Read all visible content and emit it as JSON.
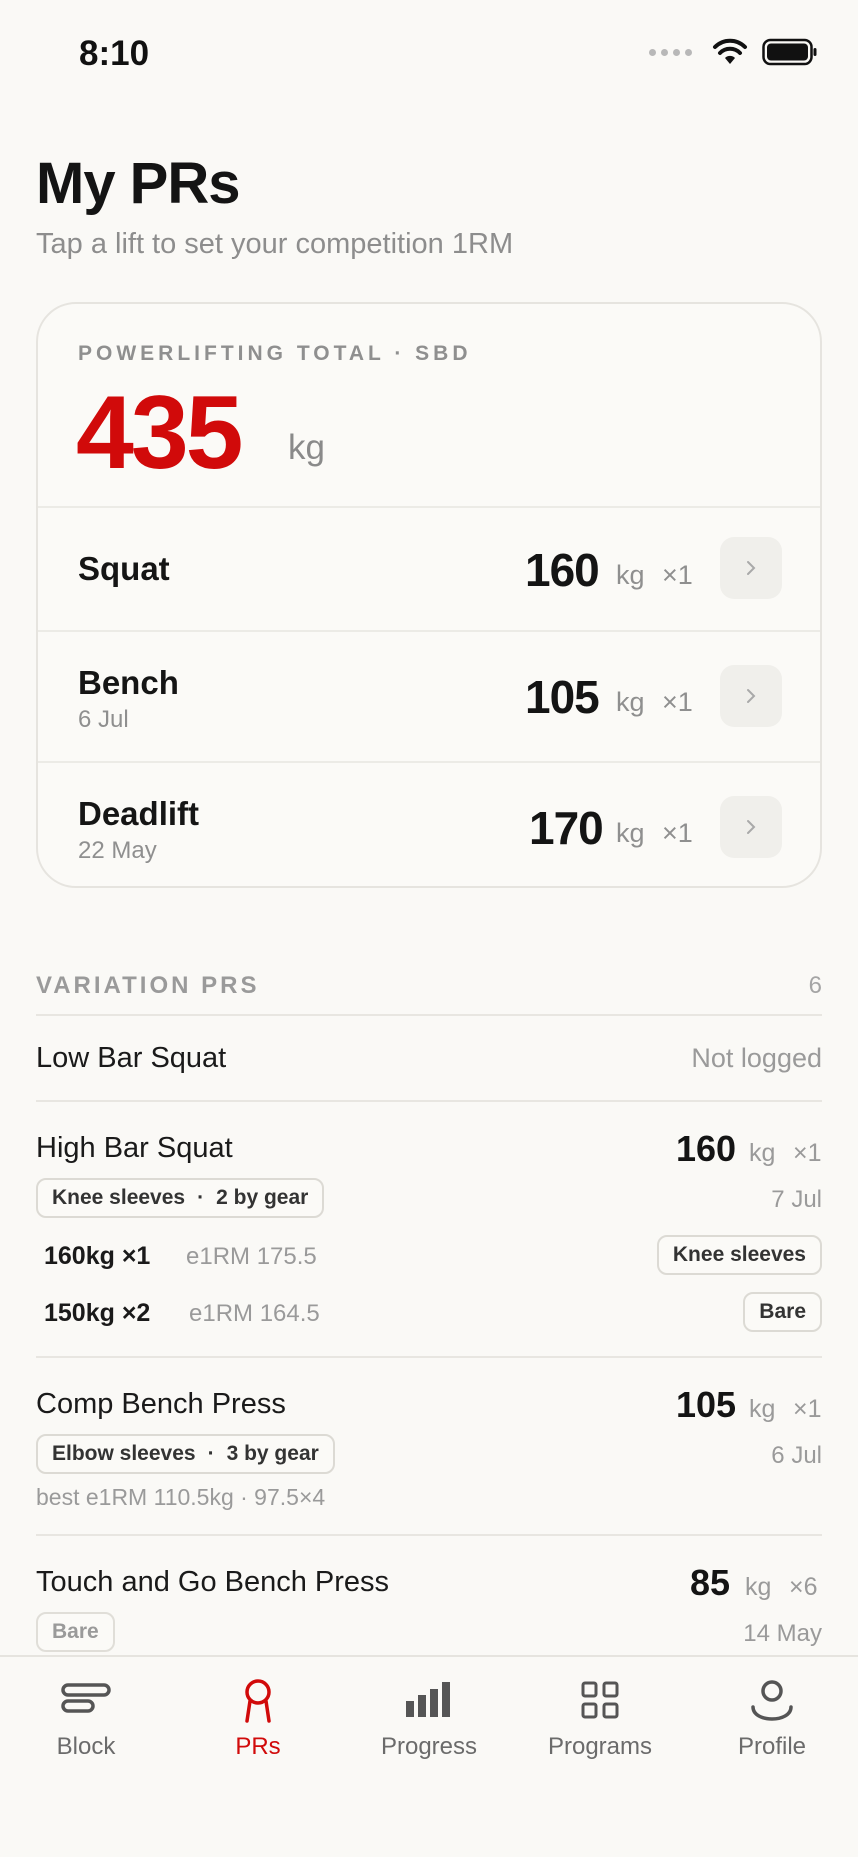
{
  "status": {
    "time": "8:10"
  },
  "header": {
    "title": "My PRs",
    "subtitle": "Tap a lift to set your competition 1RM"
  },
  "total": {
    "label": "POWERLIFTING TOTAL · SBD",
    "value": "435",
    "unit": "kg",
    "lifts": [
      {
        "name": "Squat",
        "date": "",
        "value": "160",
        "unit": "kg",
        "reps": "×1"
      },
      {
        "name": "Bench",
        "date": "6 Jul",
        "value": "105",
        "unit": "kg",
        "reps": "×1"
      },
      {
        "name": "Deadlift",
        "date": "22 May",
        "value": "170",
        "unit": "kg",
        "reps": "×1"
      }
    ]
  },
  "variations": {
    "label": "VARIATION PRS",
    "count": "6",
    "items": [
      {
        "name": "Low Bar Squat",
        "status": "Not logged"
      },
      {
        "name": "High Bar Squat",
        "value": "160",
        "unit": "kg",
        "reps": "×1",
        "date": "7 Jul",
        "chip_gear": "Knee sleeves",
        "chip_sep": "·",
        "chip_count": "2 by gear",
        "sets": [
          {
            "weight_reps": "160kg ×1",
            "e1rm": "e1RM 175.5",
            "gear": "Knee sleeves"
          },
          {
            "weight_reps": "150kg ×2",
            "e1rm": "e1RM 164.5",
            "gear": "Bare"
          }
        ]
      },
      {
        "name": "Comp Bench Press",
        "value": "105",
        "unit": "kg",
        "reps": "×1",
        "date": "6 Jul",
        "chip_gear": "Elbow sleeves",
        "chip_sep": "·",
        "chip_count": "3 by gear",
        "best": "best e1RM 110.5kg · 97.5×4"
      },
      {
        "name": "Touch and Go Bench Press",
        "value": "85",
        "unit": "kg",
        "reps": "×6",
        "date": "14 May",
        "chip_gear": "Bare"
      }
    ]
  },
  "tabs": [
    {
      "label": "Block",
      "icon": "block-icon"
    },
    {
      "label": "PRs",
      "icon": "prs-icon"
    },
    {
      "label": "Progress",
      "icon": "progress-icon"
    },
    {
      "label": "Programs",
      "icon": "programs-icon"
    },
    {
      "label": "Profile",
      "icon": "profile-icon"
    }
  ],
  "colors": {
    "accent": "#d10a0a",
    "background": "#faf9f6",
    "muted": "#9a9a9a"
  }
}
